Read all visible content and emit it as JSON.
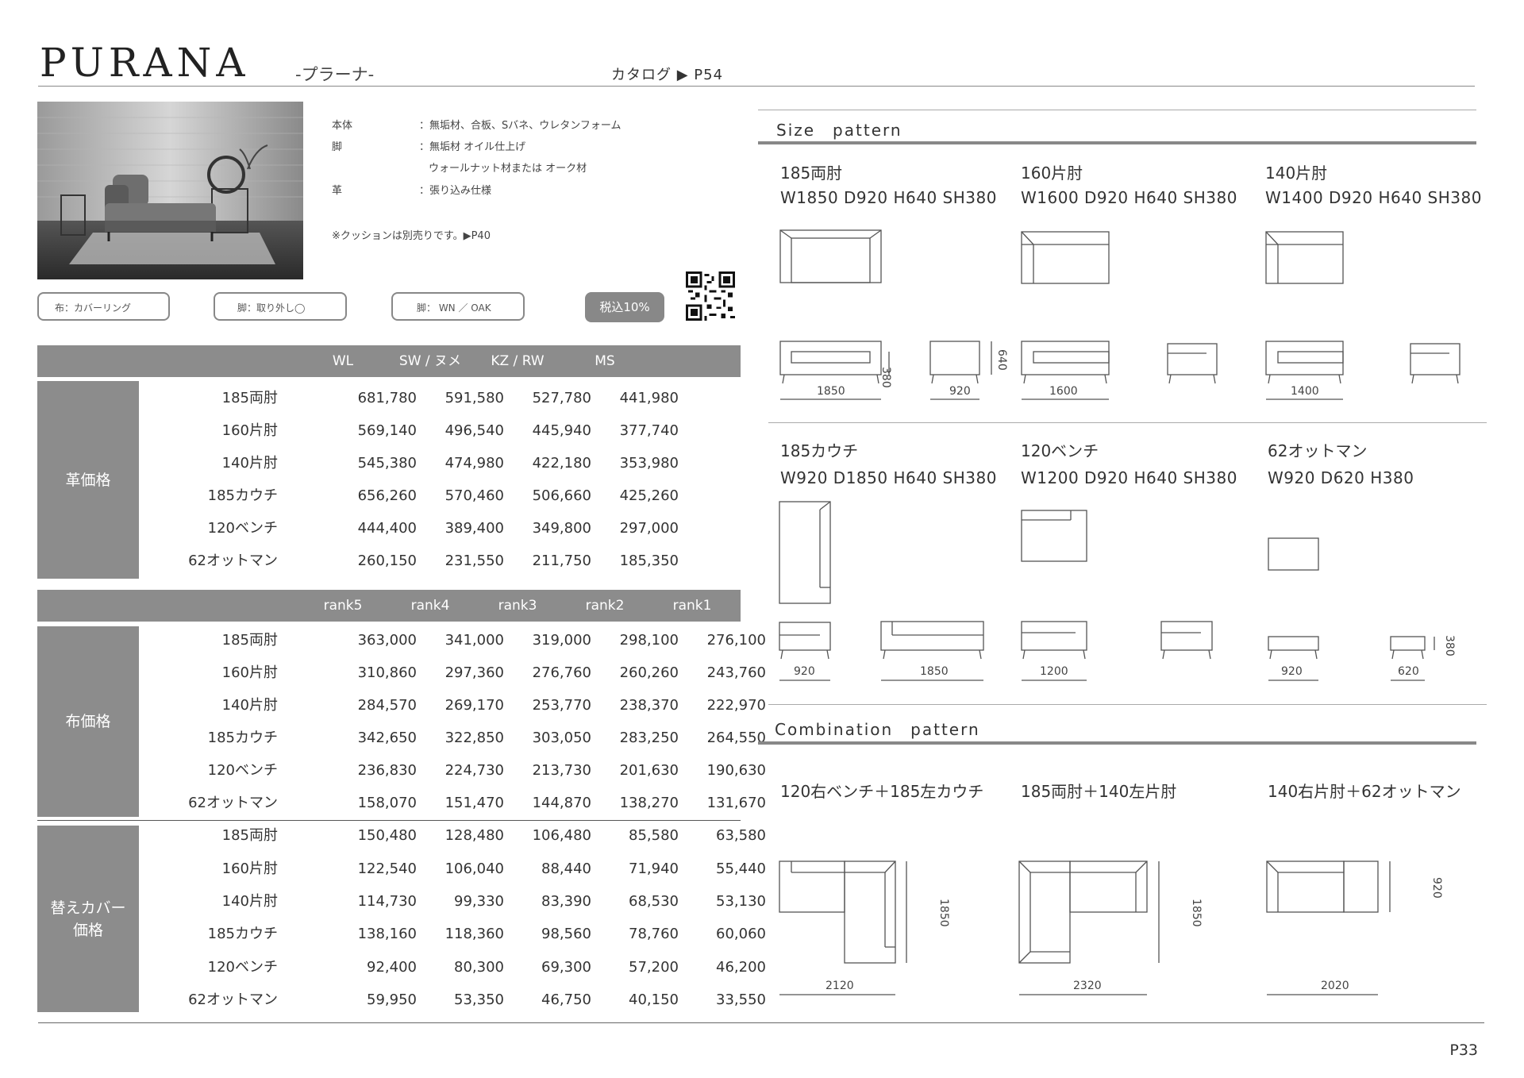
{
  "header": {
    "title": "PURANA",
    "subtitle": "-プラーナ-",
    "catalog": "カタログ ▶ P54"
  },
  "specs": [
    {
      "label": "本体",
      "value": "：無垢材、合板、Sバネ、ウレタンフォーム"
    },
    {
      "label": "脚",
      "value": "：無垢材 オイル仕上げ"
    },
    {
      "label": "",
      "value": "ウォールナット材または オーク材"
    },
    {
      "label": "革",
      "value": "：張り込み仕様"
    }
  ],
  "spec_note": "※クッションは別売りです。▶P40",
  "pills": {
    "cover": "布：カバーリング",
    "leg": "脚：取り外し◯",
    "leg_material": "脚： WN ／ OAK",
    "tax": "税込10%"
  },
  "leather": {
    "side_label": "革価格",
    "headers": [
      "WL",
      "SW / ヌメ",
      "KZ / RW",
      "MS"
    ],
    "rows": [
      {
        "name": "185両肘",
        "values": [
          "681,780",
          "591,580",
          "527,780",
          "441,980"
        ]
      },
      {
        "name": "160片肘",
        "values": [
          "569,140",
          "496,540",
          "445,940",
          "377,740"
        ]
      },
      {
        "name": "140片肘",
        "values": [
          "545,380",
          "474,980",
          "422,180",
          "353,980"
        ]
      },
      {
        "name": "185カウチ",
        "values": [
          "656,260",
          "570,460",
          "506,660",
          "425,260"
        ]
      },
      {
        "name": "120ベンチ",
        "values": [
          "444,400",
          "389,400",
          "349,800",
          "297,000"
        ]
      },
      {
        "name": "62オットマン",
        "values": [
          "260,150",
          "231,550",
          "211,750",
          "185,350"
        ]
      }
    ]
  },
  "fabric": {
    "side_label": "布価格",
    "headers": [
      "rank5",
      "rank4",
      "rank3",
      "rank2",
      "rank1"
    ],
    "rows": [
      {
        "name": "185両肘",
        "values": [
          "363,000",
          "341,000",
          "319,000",
          "298,100",
          "276,100"
        ]
      },
      {
        "name": "160片肘",
        "values": [
          "310,860",
          "297,360",
          "276,760",
          "260,260",
          "243,760"
        ]
      },
      {
        "name": "140片肘",
        "values": [
          "284,570",
          "269,170",
          "253,770",
          "238,370",
          "222,970"
        ]
      },
      {
        "name": "185カウチ",
        "values": [
          "342,650",
          "322,850",
          "303,050",
          "283,250",
          "264,550"
        ]
      },
      {
        "name": "120ベンチ",
        "values": [
          "236,830",
          "224,730",
          "213,730",
          "201,630",
          "190,630"
        ]
      },
      {
        "name": "62オットマン",
        "values": [
          "158,070",
          "151,470",
          "144,870",
          "138,270",
          "131,670"
        ]
      }
    ]
  },
  "cover": {
    "side_label_1": "替えカバー",
    "side_label_2": "価格",
    "rows": [
      {
        "name": "185両肘",
        "values": [
          "150,480",
          "128,480",
          "106,480",
          "85,580",
          "63,580"
        ]
      },
      {
        "name": "160片肘",
        "values": [
          "122,540",
          "106,040",
          "88,440",
          "71,940",
          "55,440"
        ]
      },
      {
        "name": "140片肘",
        "values": [
          "114,730",
          "99,330",
          "83,390",
          "68,530",
          "53,130"
        ]
      },
      {
        "name": "185カウチ",
        "values": [
          "138,160",
          "118,360",
          "98,560",
          "78,760",
          "60,060"
        ]
      },
      {
        "name": "120ベンチ",
        "values": [
          "92,400",
          "80,300",
          "69,300",
          "57,200",
          "46,200"
        ]
      },
      {
        "name": "62オットマン",
        "values": [
          "59,950",
          "53,350",
          "46,750",
          "40,150",
          "33,550"
        ]
      }
    ]
  },
  "size_pattern": {
    "heading": "Size　pattern",
    "items": [
      {
        "name": "185両肘",
        "dims": "W1850  D920  H640  SH380"
      },
      {
        "name": "160片肘",
        "dims": "W1600  D920  H640  SH380"
      },
      {
        "name": "140片肘",
        "dims": "W1400  D920  H640  SH380"
      },
      {
        "name": "185カウチ",
        "dims": "W920  D1850  H640  SH380"
      },
      {
        "name": "120ベンチ",
        "dims": "W1200  D920  H640  SH380"
      },
      {
        "name": "62オットマン",
        "dims": "W920  D620  H380"
      }
    ],
    "dim_labels": [
      "1850",
      "920",
      "380",
      "640",
      "1600",
      "1400",
      "920",
      "1850",
      "1200",
      "920",
      "620",
      "380"
    ]
  },
  "combination_pattern": {
    "heading": "Combination　pattern",
    "items": [
      {
        "name": "120右ベンチ＋185左カウチ",
        "width": "2120",
        "depth": "1850"
      },
      {
        "name": "185両肘＋140左片肘",
        "width": "2320",
        "depth": "1850"
      },
      {
        "name": "140右片肘＋62オットマン",
        "width": "2020",
        "depth": "920"
      }
    ]
  },
  "page_number": "P33"
}
